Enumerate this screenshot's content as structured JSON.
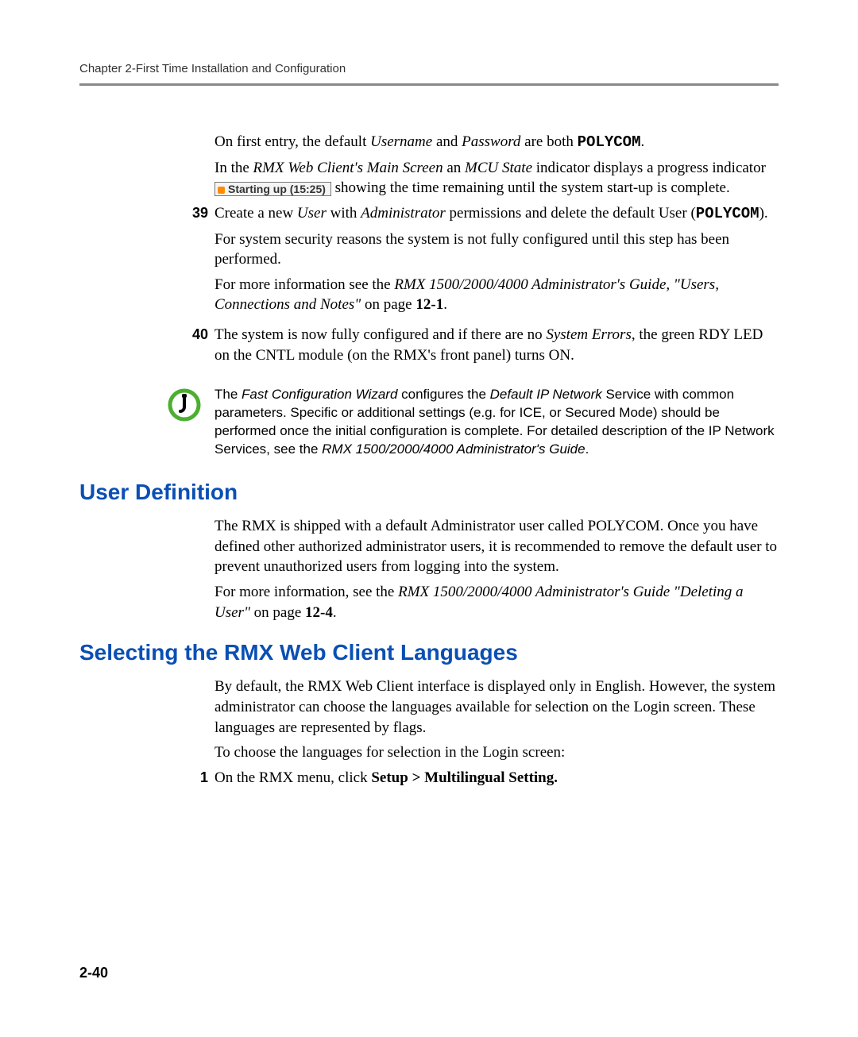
{
  "header": {
    "running": "Chapter 2-First Time Installation and Configuration"
  },
  "intro": {
    "p1_a": "On first entry, the default ",
    "p1_b": "Username",
    "p1_c": " and ",
    "p1_d": "Password",
    "p1_e": " are both ",
    "p1_f": "POLYCOM",
    "p1_g": ".",
    "p2_a": "In the ",
    "p2_b": "RMX Web Client's Main Screen",
    "p2_c": " an ",
    "p2_d": "MCU State",
    "p2_e": " indicator displays a progress indicator ",
    "p2_badge": "Starting up (15:25)",
    "p2_f": " showing the time remaining until the system start-up is complete."
  },
  "step39": {
    "num": "39",
    "a": "Create a new ",
    "b": "User",
    "c": " with ",
    "d": "Administrator",
    "e": " permissions and delete the default User (",
    "f": "POLYCOM",
    "g": ").",
    "p2": "For system security reasons the system is not fully configured until this step has been performed.",
    "p3_a": "For more information see the ",
    "p3_b": "RMX 1500/2000/4000 Administrator's Guide, \"Users, Connections and Notes\"",
    "p3_c": " on page ",
    "p3_d": "12-1",
    "p3_e": "."
  },
  "step40": {
    "num": "40",
    "a": "The system is now fully configured and if there are no ",
    "b": "System Errors",
    "c": ", the green RDY LED on the CNTL module (on the RMX's front panel) turns ON."
  },
  "note": {
    "a": "The ",
    "b": "Fast Configuration Wizard",
    "c": " configures the ",
    "d": "Default IP Network",
    "e": " Service with common parameters. Specific or additional settings (e.g. for ICE, or Secured Mode) should be performed once the initial configuration is complete. For detailed description of the IP Network Services, see the ",
    "f": "RMX 1500/2000/4000 Administrator's Guide",
    "g": "."
  },
  "userdef": {
    "heading": "User Definition",
    "p1": "The RMX is shipped with a default Administrator user called POLYCOM. Once you have defined other authorized administrator users, it is recommended to remove the default user to prevent unauthorized users from logging into the system.",
    "p2_a": "For more information, see the ",
    "p2_b": "RMX 1500/2000/4000 Administrator's Guide \"Deleting a User\"",
    "p2_c": " on page ",
    "p2_d": "12-4",
    "p2_e": "."
  },
  "lang": {
    "heading": "Selecting the RMX Web Client Languages",
    "p1": "By default, the RMX Web Client interface is displayed only in English. However, the system administrator can choose the languages available for selection on the Login screen. These languages are represented by flags.",
    "p2": "To choose the languages for selection in the Login screen:",
    "s1_num": "1",
    "s1_a": "On the RMX menu, click ",
    "s1_b": "Setup > Multilingual Setting."
  },
  "pageNumber": "2-40"
}
